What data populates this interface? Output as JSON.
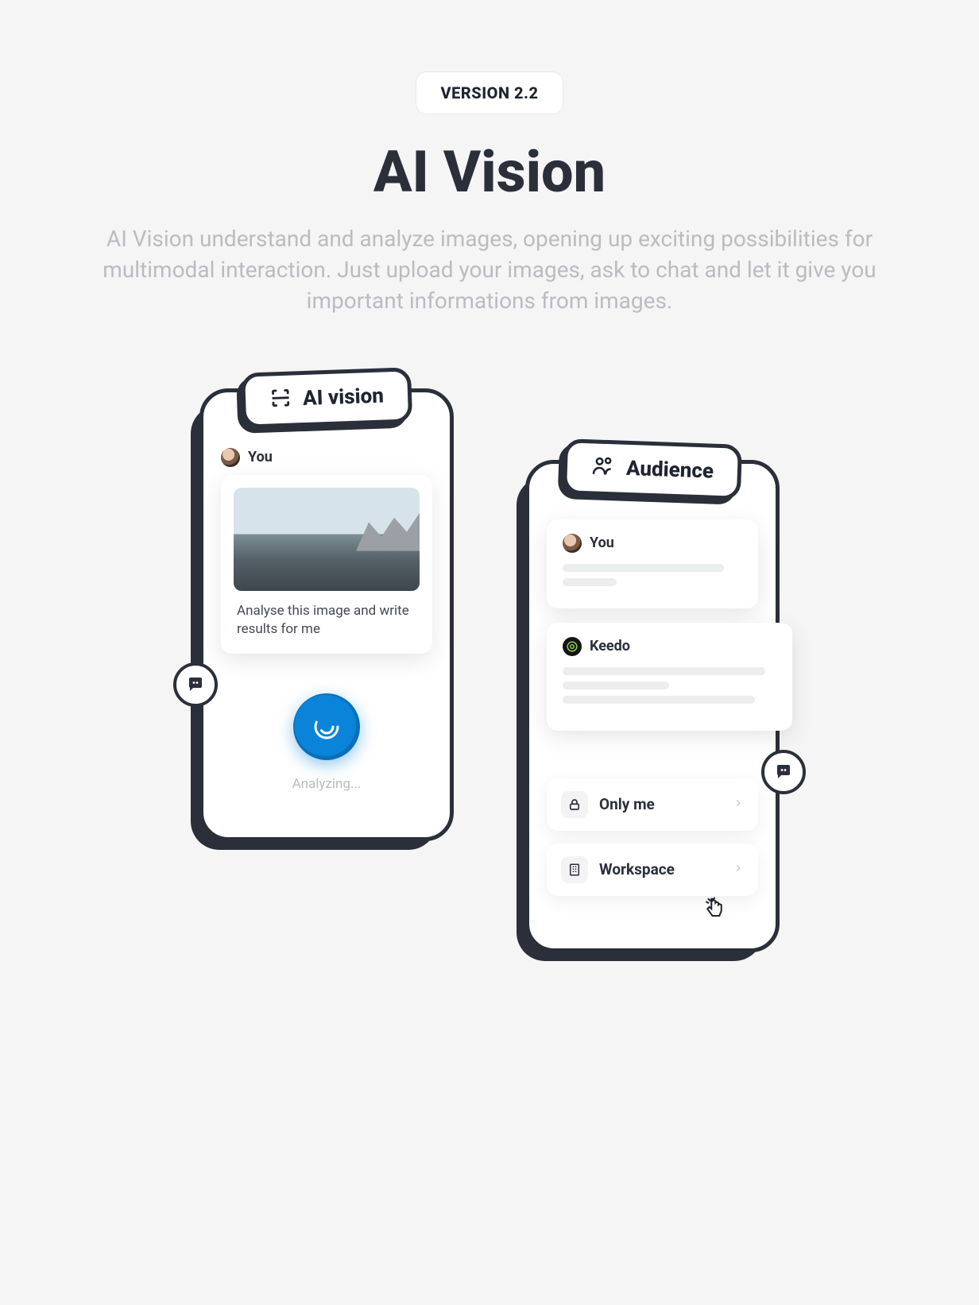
{
  "version_label": "VERSION 2.2",
  "title": "AI Vision",
  "subtitle": "AI Vision understand and analyze images, opening up exciting possibilities for multimodal interaction. Just upload your images, ask to chat and let it give you important informations from images.",
  "left_card": {
    "header": "AI vision",
    "user_label": "You",
    "user_message": "Analyse this image and write results for me",
    "status_text": "Analyzing..."
  },
  "right_card": {
    "header": "Audience",
    "user_label": "You",
    "bot_name": "Keedo",
    "options": {
      "only_me": "Only me",
      "workspace": "Workspace"
    }
  }
}
